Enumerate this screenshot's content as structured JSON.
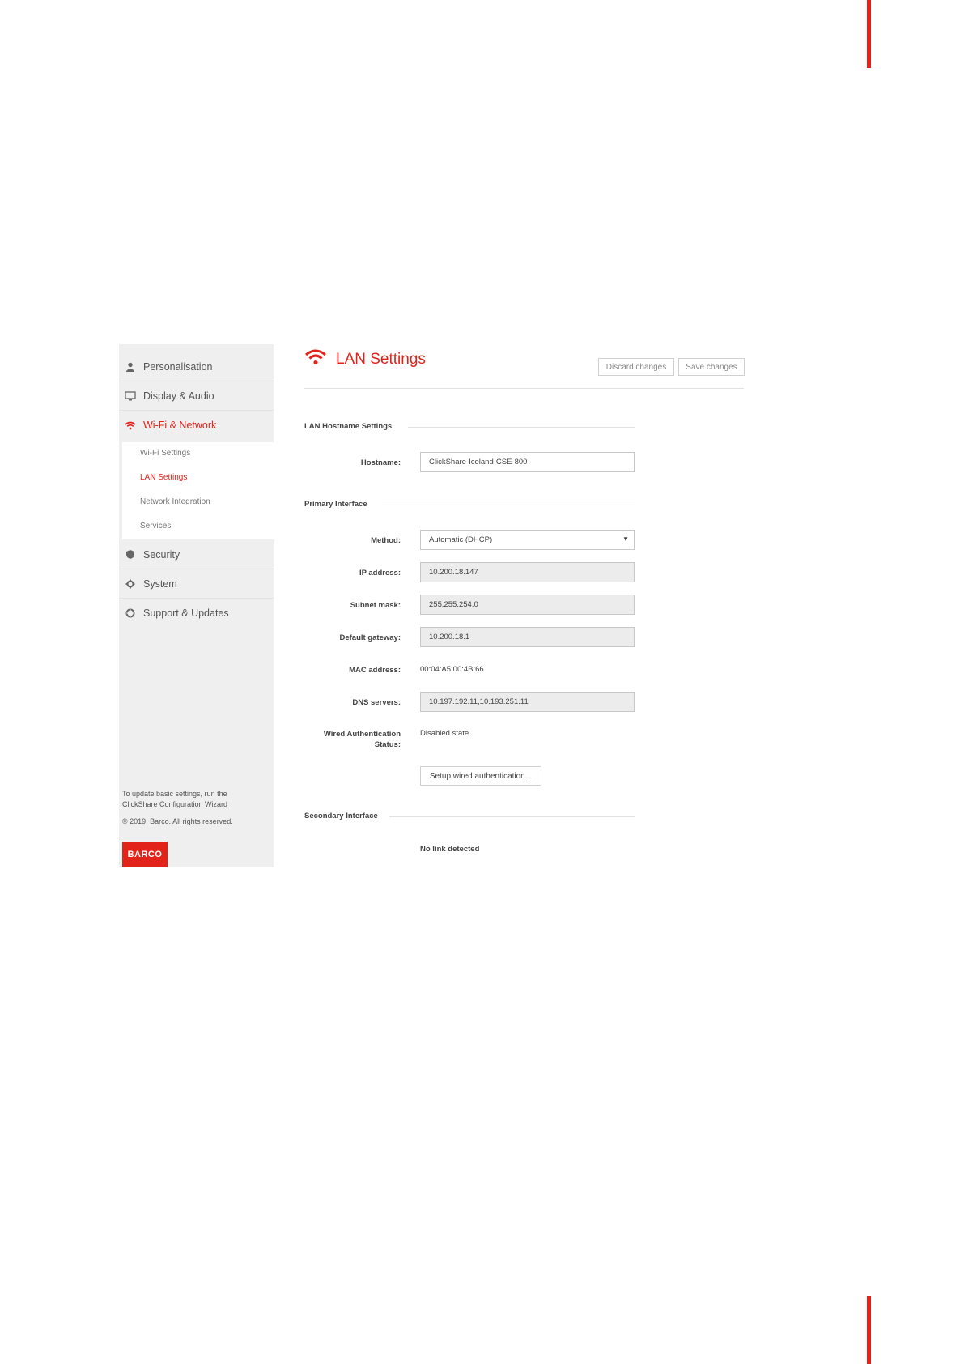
{
  "sidebar": {
    "items": [
      {
        "label": "Personalisation",
        "icon": "person-icon"
      },
      {
        "label": "Display & Audio",
        "icon": "monitor-icon"
      },
      {
        "label": "Wi-Fi & Network",
        "icon": "wifi-icon",
        "active": true
      },
      {
        "label": "Security",
        "icon": "shield-icon"
      },
      {
        "label": "System",
        "icon": "gear-icon"
      },
      {
        "label": "Support & Updates",
        "icon": "lifebuoy-icon"
      }
    ],
    "subitems": [
      {
        "label": "Wi-Fi Settings"
      },
      {
        "label": "LAN Settings",
        "active": true
      },
      {
        "label": "Network Integration"
      },
      {
        "label": "Services"
      }
    ],
    "footer": {
      "line1": "To update basic settings, run the",
      "link": "ClickShare Configuration Wizard",
      "copyright": "© 2019, Barco. All rights reserved.",
      "logo": "BARCO"
    }
  },
  "header": {
    "title": "LAN Settings",
    "discard_label": "Discard changes",
    "save_label": "Save changes"
  },
  "sections": {
    "hostname": "LAN Hostname Settings",
    "primary": "Primary Interface",
    "secondary": "Secondary Interface"
  },
  "fields": {
    "hostname_label": "Hostname:",
    "hostname_value": "ClickShare-Iceland-CSE-800",
    "method_label": "Method:",
    "method_value": "Automatic (DHCP)",
    "ip_label": "IP address:",
    "ip_value": "10.200.18.147",
    "subnet_label": "Subnet mask:",
    "subnet_value": "255.255.254.0",
    "gateway_label": "Default gateway:",
    "gateway_value": "10.200.18.1",
    "mac_label": "MAC address:",
    "mac_value": "00:04:A5:00:4B:66",
    "dns_label": "DNS servers:",
    "dns_value": "10.197.192.11,10.193.251.11",
    "wired_auth_label_1": "Wired Authentication",
    "wired_auth_label_2": "Status:",
    "wired_auth_value": "Disabled state.",
    "wired_auth_button": "Setup wired authentication...",
    "secondary_status": "No link detected"
  },
  "colors": {
    "accent": "#e2231a",
    "sidebar_bg": "#efefef"
  }
}
